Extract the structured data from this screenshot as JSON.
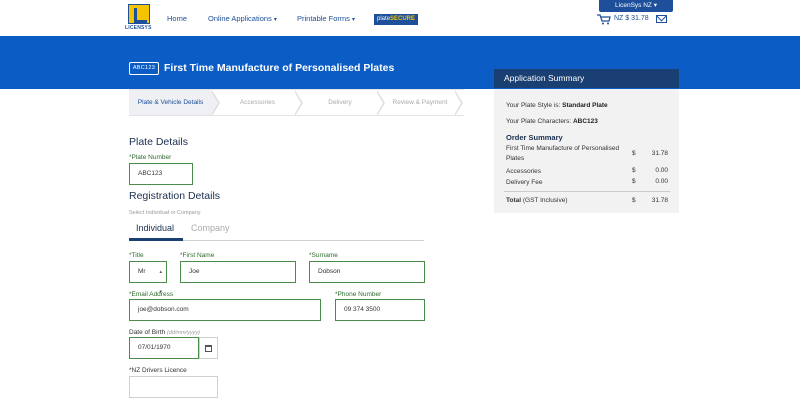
{
  "brand": {
    "logo_text": "LICENSYS"
  },
  "nav": {
    "home": "Home",
    "online_applications": "Online Applications",
    "printable_forms": "Printable Forms",
    "plate_secure_prefix": "plate",
    "plate_secure_suffix": "SECURE",
    "account": "LicenSys NZ",
    "cart_total": "NZ $ 31.78"
  },
  "header": {
    "plate_chip": "ABC123",
    "title": "First Time Manufacture of Personalised Plates"
  },
  "steps": [
    {
      "label": "Plate & Vehicle Details",
      "active": true
    },
    {
      "label": "Accessories",
      "active": false
    },
    {
      "label": "Delivery",
      "active": false
    },
    {
      "label": "Review & Payment",
      "active": false
    }
  ],
  "form": {
    "plate_details_title": "Plate Details",
    "plate_number_label": "*Plate Number",
    "plate_number_value": "ABC123",
    "registration_title": "Registration Details",
    "registration_note": "Select Individual or Company",
    "tab_individual": "Individual",
    "tab_company": "Company",
    "title_label": "*Title",
    "title_value": "Mr",
    "first_name_label": "*First Name",
    "first_name_value": "Joe",
    "surname_label": "*Surname",
    "surname_value": "Dobson",
    "email_label": "*Email Address",
    "email_value": "joe@dobson.com",
    "phone_label": "*Phone Number",
    "phone_value": "09 374 3500",
    "dob_label": "Date of Birth",
    "dob_hint": "(dd/mm/yyyy)",
    "dob_value": "07/01/1970",
    "licence_label": "*NZ Drivers Licence",
    "licence_value": ""
  },
  "summary": {
    "heading": "Application Summary",
    "style_prefix": "Your Plate Style is:",
    "style_value": "Standard Plate",
    "chars_prefix": "Your Plate Characters:",
    "chars_value": "ABC123",
    "order_title": "Order Summary",
    "rows": [
      {
        "label": "First Time Manufacture of Personalised Plates",
        "currency": "$",
        "value": "31.78"
      },
      {
        "label": "Accessories",
        "currency": "$",
        "value": "0.00"
      },
      {
        "label": "Delivery Fee",
        "currency": "$",
        "value": "0.00"
      }
    ],
    "total_label": "Total",
    "total_note": "(GST Inclusive)",
    "total_currency": "$",
    "total_value": "31.78"
  },
  "colors": {
    "brand_blue": "#0b5cc4",
    "navy": "#1a3f73",
    "field_border_green": "#4a8c4a",
    "logo_yellow": "#f5c400"
  }
}
